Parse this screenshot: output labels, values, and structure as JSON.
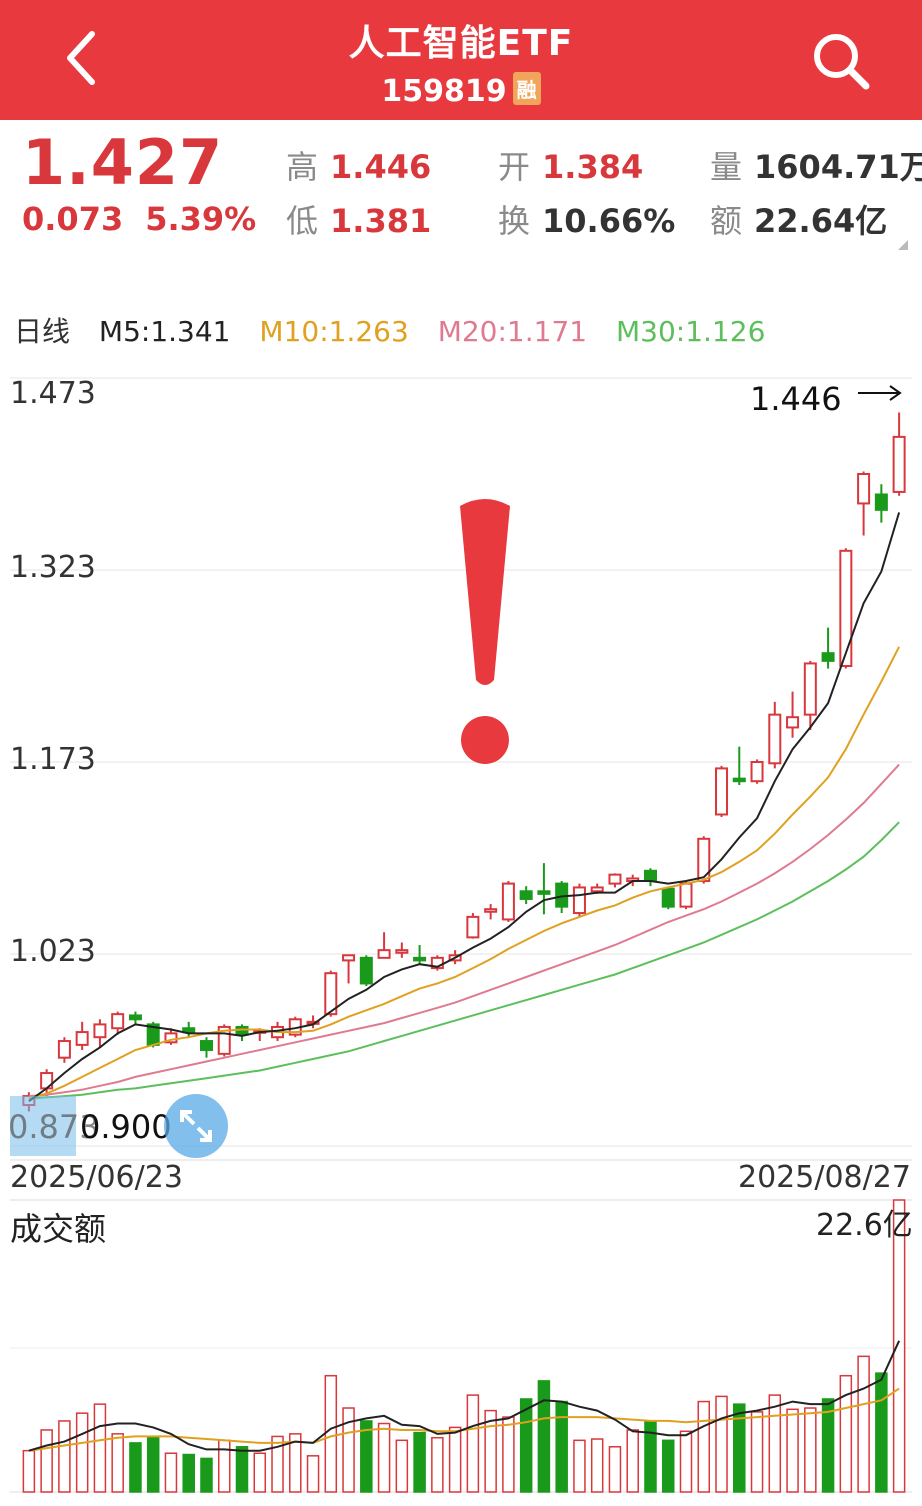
{
  "header": {
    "title": "人工智能ETF",
    "code": "159819",
    "margin_badge": "融",
    "back_icon": "back-chevron-icon",
    "search_icon": "search-icon",
    "bg_color": "#e8393e"
  },
  "quote": {
    "price": "1.427",
    "change": "0.073",
    "change_pct": "5.39%",
    "high_label": "高",
    "high": "1.446",
    "low_label": "低",
    "low": "1.381",
    "open_label": "开",
    "open": "1.384",
    "turnover_label": "换",
    "turnover": "10.66%",
    "volume_label": "量",
    "volume": "1604.71万",
    "amount_label": "额",
    "amount": "22.64亿"
  },
  "ma_bar": {
    "period": "日线",
    "m5": "M5:1.341",
    "m10": "M10:1.263",
    "m20": "M20:1.171",
    "m30": "M30:1.126",
    "colors": {
      "m5": "#222222",
      "m10": "#e0a020",
      "m20": "#e07a90",
      "m30": "#5cbf5c"
    }
  },
  "chart_data": {
    "type": "candlestick",
    "y_ticks": [
      "1.473",
      "1.323",
      "1.173",
      "1.023"
    ],
    "ylim": [
      0.873,
      1.473
    ],
    "x_start": "2025/06/23",
    "x_end": "2025/08/27",
    "high_marker": "1.446",
    "low_marker": "0.900",
    "low_marker_obscured": "0.873",
    "candles": [
      [
        0.905,
        0.912,
        0.9,
        0.915
      ],
      [
        0.918,
        0.93,
        0.912,
        0.933
      ],
      [
        0.942,
        0.955,
        0.938,
        0.958
      ],
      [
        0.952,
        0.962,
        0.948,
        0.97
      ],
      [
        0.958,
        0.968,
        0.95,
        0.972
      ],
      [
        0.965,
        0.976,
        0.96,
        0.978
      ],
      [
        0.975,
        0.972,
        0.968,
        0.978
      ],
      [
        0.968,
        0.952,
        0.95,
        0.97
      ],
      [
        0.954,
        0.961,
        0.952,
        0.965
      ],
      [
        0.965,
        0.962,
        0.958,
        0.97
      ],
      [
        0.955,
        0.948,
        0.942,
        0.958
      ],
      [
        0.945,
        0.966,
        0.943,
        0.968
      ],
      [
        0.966,
        0.96,
        0.955,
        0.968
      ],
      [
        0.962,
        0.963,
        0.955,
        0.965
      ],
      [
        0.958,
        0.966,
        0.955,
        0.97
      ],
      [
        0.96,
        0.972,
        0.958,
        0.974
      ],
      [
        0.97,
        0.97,
        0.965,
        0.975
      ],
      [
        0.976,
        1.008,
        0.974,
        1.01
      ],
      [
        1.018,
        1.022,
        1.0,
        1.02
      ],
      [
        1.02,
        1.0,
        0.998,
        1.022
      ],
      [
        1.02,
        1.026,
        1.022,
        1.04
      ],
      [
        1.024,
        1.026,
        1.02,
        1.032
      ],
      [
        1.02,
        1.018,
        1.015,
        1.03
      ],
      [
        1.012,
        1.02,
        1.01,
        1.022
      ],
      [
        1.018,
        1.022,
        1.015,
        1.026
      ],
      [
        1.036,
        1.052,
        1.035,
        1.055
      ],
      [
        1.056,
        1.058,
        1.05,
        1.062
      ],
      [
        1.05,
        1.078,
        1.048,
        1.08
      ],
      [
        1.072,
        1.066,
        1.062,
        1.076
      ],
      [
        1.072,
        1.07,
        1.054,
        1.094
      ],
      [
        1.078,
        1.06,
        1.055,
        1.08
      ],
      [
        1.055,
        1.075,
        1.052,
        1.078
      ],
      [
        1.072,
        1.075,
        1.07,
        1.078
      ],
      [
        1.078,
        1.085,
        1.075,
        1.086
      ],
      [
        1.08,
        1.082,
        1.076,
        1.085
      ],
      [
        1.088,
        1.08,
        1.076,
        1.09
      ],
      [
        1.074,
        1.06,
        1.058,
        1.075
      ],
      [
        1.06,
        1.078,
        1.058,
        1.08
      ],
      [
        1.08,
        1.113,
        1.078,
        1.115
      ],
      [
        1.132,
        1.168,
        1.13,
        1.17
      ],
      [
        1.16,
        1.158,
        1.155,
        1.185
      ],
      [
        1.158,
        1.173,
        1.156,
        1.175
      ],
      [
        1.172,
        1.21,
        1.168,
        1.22
      ],
      [
        1.2,
        1.208,
        1.192,
        1.228
      ],
      [
        1.21,
        1.25,
        1.198,
        1.252
      ],
      [
        1.258,
        1.252,
        1.246,
        1.278
      ],
      [
        1.248,
        1.338,
        1.246,
        1.34
      ],
      [
        1.375,
        1.398,
        1.35,
        1.4
      ],
      [
        1.382,
        1.37,
        1.36,
        1.39
      ],
      [
        1.384,
        1.427,
        1.381,
        1.446
      ]
    ],
    "ma5": [
      0.908,
      0.918,
      0.93,
      0.941,
      0.95,
      0.961,
      0.968,
      0.966,
      0.964,
      0.961,
      0.961,
      0.961,
      0.959,
      0.962,
      0.963,
      0.965,
      0.968,
      0.978,
      0.988,
      0.995,
      1.005,
      1.011,
      1.015,
      1.013,
      1.02,
      1.028,
      1.035,
      1.044,
      1.056,
      1.065,
      1.068,
      1.069,
      1.071,
      1.071,
      1.08,
      1.08,
      1.078,
      1.08,
      1.083,
      1.097,
      1.114,
      1.129,
      1.158,
      1.183,
      1.2,
      1.219,
      1.258,
      1.297,
      1.322,
      1.368
    ],
    "ma10": [
      0.91,
      0.914,
      0.92,
      0.927,
      0.934,
      0.941,
      0.948,
      0.952,
      0.956,
      0.958,
      0.961,
      0.963,
      0.964,
      0.964,
      0.962,
      0.962,
      0.963,
      0.968,
      0.974,
      0.979,
      0.984,
      0.99,
      0.996,
      1.0,
      1.005,
      1.012,
      1.019,
      1.027,
      1.034,
      1.041,
      1.047,
      1.052,
      1.057,
      1.061,
      1.067,
      1.072,
      1.075,
      1.078,
      1.081,
      1.087,
      1.095,
      1.104,
      1.117,
      1.132,
      1.146,
      1.161,
      1.183,
      1.21,
      1.236,
      1.263
    ],
    "ma20": [
      0.912,
      0.913,
      0.915,
      0.917,
      0.92,
      0.923,
      0.927,
      0.93,
      0.933,
      0.936,
      0.939,
      0.942,
      0.945,
      0.948,
      0.951,
      0.954,
      0.957,
      0.96,
      0.963,
      0.966,
      0.969,
      0.973,
      0.977,
      0.981,
      0.985,
      0.99,
      0.995,
      1.0,
      1.005,
      1.01,
      1.015,
      1.02,
      1.025,
      1.03,
      1.036,
      1.042,
      1.048,
      1.053,
      1.058,
      1.064,
      1.071,
      1.078,
      1.086,
      1.095,
      1.105,
      1.116,
      1.128,
      1.141,
      1.156,
      1.171
    ],
    "ma30": [
      0.91,
      0.911,
      0.912,
      0.913,
      0.915,
      0.917,
      0.918,
      0.92,
      0.922,
      0.924,
      0.926,
      0.928,
      0.93,
      0.932,
      0.935,
      0.938,
      0.941,
      0.944,
      0.947,
      0.951,
      0.955,
      0.959,
      0.963,
      0.967,
      0.971,
      0.975,
      0.979,
      0.983,
      0.987,
      0.991,
      0.995,
      0.999,
      1.003,
      1.007,
      1.012,
      1.017,
      1.022,
      1.027,
      1.032,
      1.038,
      1.044,
      1.05,
      1.057,
      1.064,
      1.072,
      1.08,
      1.089,
      1.099,
      1.112,
      1.126
    ],
    "amount_title": "成交额",
    "amount_max_label": "22.6亿",
    "amount": [
      3.2,
      4.8,
      5.5,
      6.1,
      6.8,
      4.5,
      3.8,
      4.2,
      3.0,
      2.9,
      2.6,
      4.0,
      3.5,
      3.0,
      4.3,
      4.5,
      2.8,
      9.0,
      6.5,
      5.5,
      5.3,
      4.0,
      4.6,
      4.2,
      5.0,
      7.5,
      6.3,
      5.8,
      7.2,
      8.6,
      7.0,
      4.0,
      4.1,
      3.5,
      4.8,
      5.4,
      4.0,
      4.7,
      7.0,
      7.4,
      6.8,
      6.2,
      7.5,
      6.4,
      6.5,
      7.2,
      9.0,
      10.5,
      9.2,
      22.6
    ],
    "amount_ma_a": [
      3.2,
      3.6,
      3.9,
      4.5,
      5.1,
      5.3,
      5.3,
      5.0,
      4.5,
      3.7,
      3.3,
      3.3,
      3.2,
      3.2,
      3.5,
      3.9,
      3.8,
      4.9,
      5.4,
      5.7,
      5.9,
      5.2,
      5.1,
      4.5,
      4.6,
      5.1,
      5.5,
      5.7,
      6.4,
      7.1,
      7.0,
      6.6,
      6.3,
      5.6,
      4.7,
      4.6,
      4.4,
      4.4,
      5.1,
      5.7,
      6.1,
      6.3,
      6.6,
      7.0,
      6.8,
      6.8,
      7.5,
      8.0,
      8.7,
      11.7
    ],
    "amount_ma_b": [
      3.2,
      3.4,
      3.6,
      3.8,
      4.0,
      4.2,
      4.3,
      4.3,
      4.3,
      4.2,
      4.1,
      4.0,
      3.9,
      3.8,
      3.8,
      3.9,
      3.8,
      4.3,
      4.6,
      4.8,
      4.9,
      4.8,
      4.8,
      4.7,
      4.7,
      4.9,
      5.1,
      5.2,
      5.4,
      5.7,
      5.8,
      5.8,
      5.8,
      5.7,
      5.6,
      5.5,
      5.5,
      5.4,
      5.5,
      5.6,
      5.7,
      5.8,
      5.9,
      6.0,
      6.1,
      6.2,
      6.5,
      6.8,
      7.1,
      8.0
    ],
    "up_color": "#d8373c",
    "down_color": "#1a9a1a"
  },
  "overlays": {
    "exclamation_color": "#e8393e",
    "zoom_icon": "expand-arrows-icon",
    "arrow_icon": "right-arrow-icon"
  }
}
